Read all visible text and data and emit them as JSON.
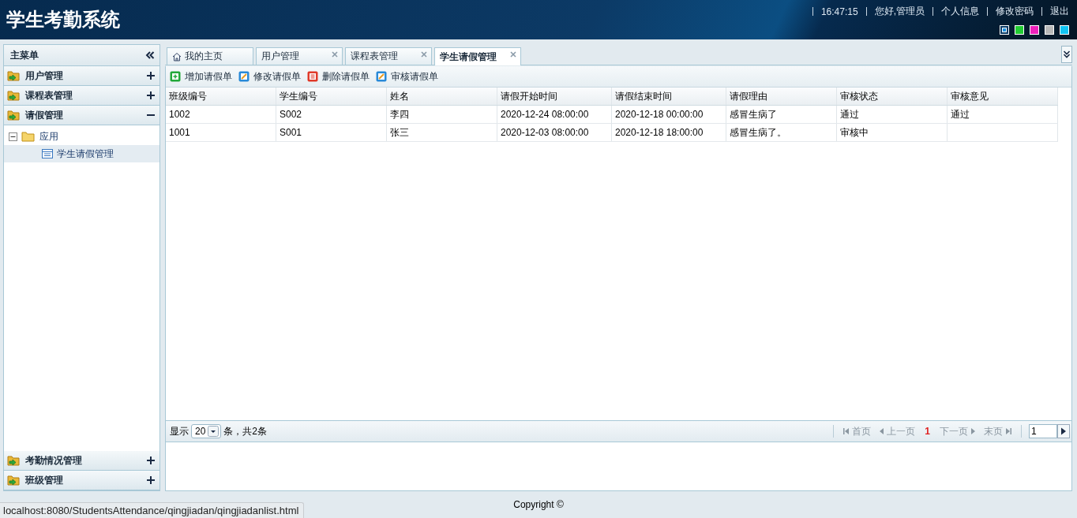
{
  "header": {
    "title": "学生考勤系统",
    "time": "16:47:15",
    "greeting": "您好,管理员",
    "links": [
      "个人信息",
      "修改密码",
      "退出"
    ],
    "themes": [
      {
        "color": "#1a8fe0",
        "selected": true
      },
      {
        "color": "#22cc33",
        "selected": false
      },
      {
        "color": "#ee22bb",
        "selected": false
      },
      {
        "color": "#b8b8b8",
        "selected": false
      },
      {
        "color": "#11c4f4",
        "selected": false
      }
    ]
  },
  "sidebar": {
    "title": "主菜单",
    "panels": [
      {
        "label": "用户管理",
        "expanded": false
      },
      {
        "label": "课程表管理",
        "expanded": false
      },
      {
        "label": "请假管理",
        "expanded": true,
        "tree": [
          {
            "label": "应用",
            "kind": "folder",
            "expanded": true,
            "selected": false,
            "children": [
              {
                "label": "学生请假管理",
                "kind": "page",
                "selected": true
              }
            ]
          }
        ]
      },
      {
        "label": "考勤情况管理",
        "expanded": false
      },
      {
        "label": "班级管理",
        "expanded": false
      }
    ]
  },
  "tabs": [
    {
      "label": "我的主页",
      "kind": "home",
      "selected": false,
      "closable": false
    },
    {
      "label": "用户管理",
      "kind": "page",
      "selected": false,
      "closable": true
    },
    {
      "label": "课程表管理",
      "kind": "page",
      "selected": false,
      "closable": true
    },
    {
      "label": "学生请假管理",
      "kind": "page",
      "selected": true,
      "closable": true
    }
  ],
  "toolbar": [
    {
      "label": "增加请假单",
      "kind": "add"
    },
    {
      "label": "修改请假单",
      "kind": "edit"
    },
    {
      "label": "删除请假单",
      "kind": "delete"
    },
    {
      "label": "审核请假单",
      "kind": "edit"
    }
  ],
  "table": {
    "columns": [
      "班级编号",
      "学生编号",
      "姓名",
      "请假开始时间",
      "请假结束时间",
      "请假理由",
      "审核状态",
      "审核意见"
    ],
    "rows": [
      [
        "1002",
        "S002",
        "李四",
        "2020-12-24 08:00:00",
        "2020-12-18 00:00:00",
        "感冒生病了",
        "通过",
        "通过"
      ],
      [
        "1001",
        "S001",
        "张三",
        "2020-12-03 08:00:00",
        "2020-12-18 18:00:00",
        "感冒生病了。",
        "审核中"
      ]
    ]
  },
  "pager": {
    "show_label": "显示",
    "page_size": "20",
    "summary": "条，共2条",
    "nav": [
      {
        "label": "首页",
        "kind": "first",
        "disabled": true
      },
      {
        "label": "上一页",
        "kind": "prev",
        "disabled": true
      },
      {
        "label": "1",
        "kind": "current"
      },
      {
        "label": "下一页",
        "kind": "next",
        "disabled": true
      },
      {
        "label": "末页",
        "kind": "last",
        "disabled": true
      }
    ],
    "page_input": "1"
  },
  "footer": {
    "copyright": "Copyright ©"
  },
  "status_bar": {
    "url": "localhost:8080/StudentsAttendance/qingjiadan/qingjiadanlist.html"
  }
}
